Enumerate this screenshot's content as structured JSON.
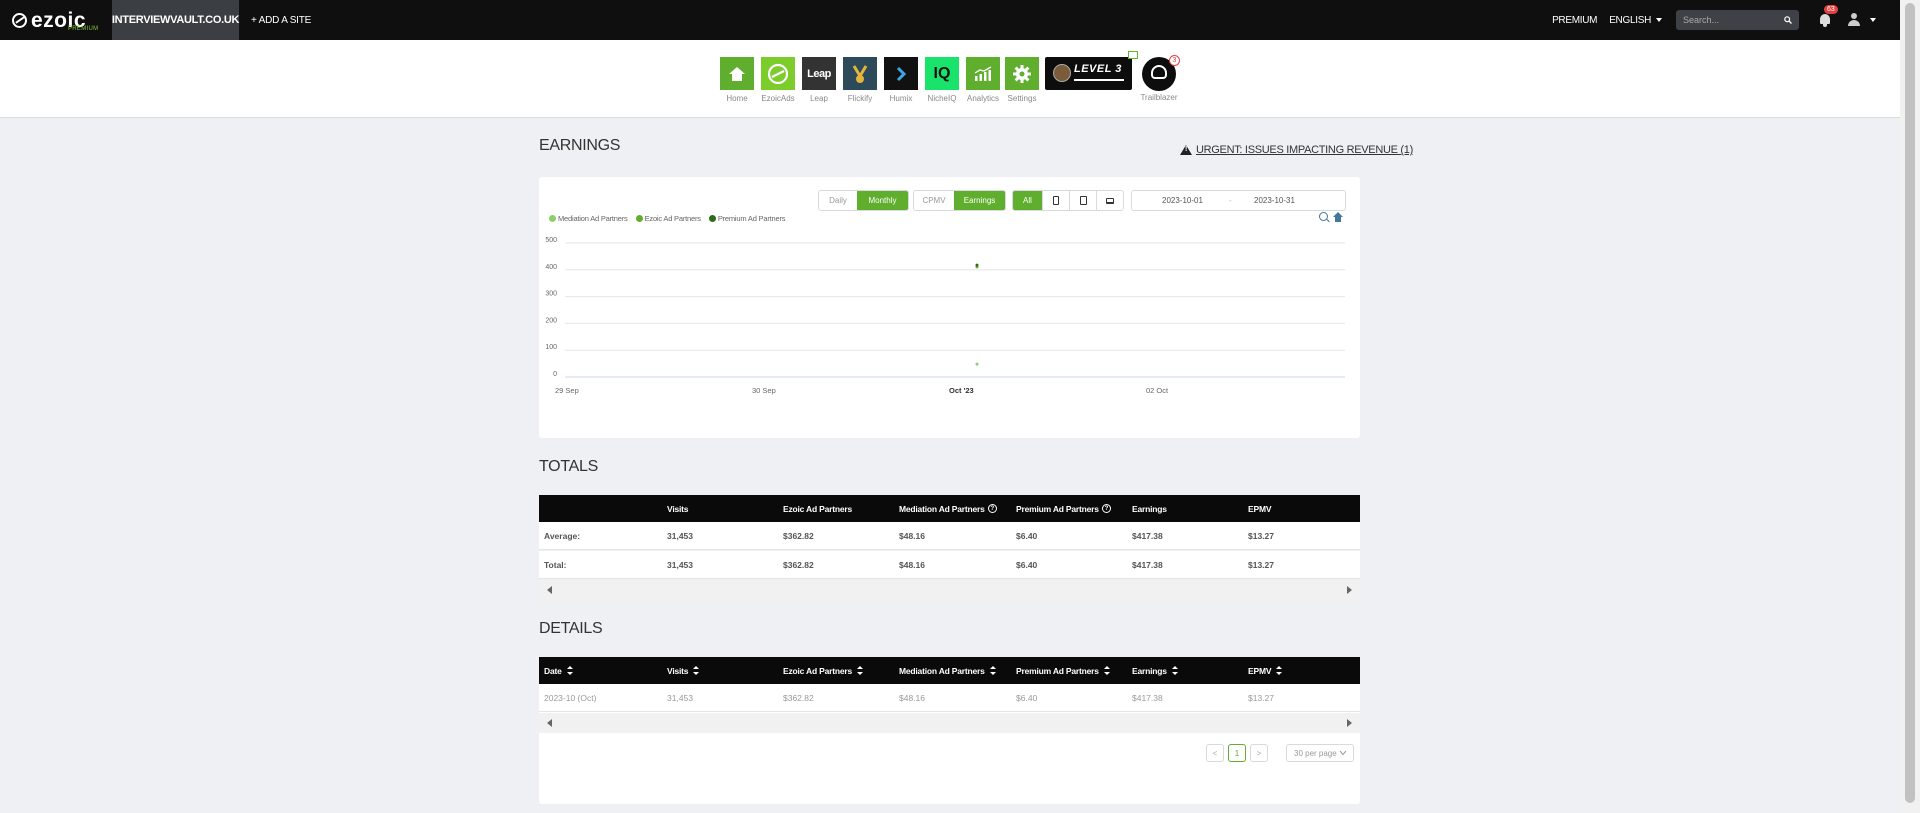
{
  "topbar": {
    "logo_text": "ezoic",
    "logo_sub": "PREMIUM",
    "site_name": "INTERVIEWVAULT.CO.UK",
    "add_site": "+ ADD A SITE",
    "premium": "PREMIUM",
    "language": "ENGLISH",
    "search_placeholder": "Search...",
    "notifications_count": "63"
  },
  "apps": [
    {
      "label": "Home",
      "color": "#5fae2e",
      "icon": "home-icon"
    },
    {
      "label": "EzoicAds",
      "color": "#7ccc2c",
      "icon": "ezoicads-icon"
    },
    {
      "label": "Leap",
      "color": "#333333",
      "icon": "leap-icon",
      "mark": "Leap"
    },
    {
      "label": "Flickify",
      "color": "#2d4a5a",
      "icon": "flickify-icon"
    },
    {
      "label": "Humix",
      "color": "#111111",
      "icon": "humix-icon"
    },
    {
      "label": "NicheIQ",
      "color": "#19e36b",
      "icon": "nicheiq-icon",
      "mark": "IQ"
    },
    {
      "label": "Analytics",
      "color": "#5fae2e",
      "icon": "analytics-icon"
    },
    {
      "label": "Settings",
      "color": "#5fae2e",
      "icon": "gear-icon"
    }
  ],
  "level": {
    "text": "LEVEL 3"
  },
  "trailblazer": {
    "label": "Trailblazer",
    "badge": "3"
  },
  "earnings": {
    "title": "EARNINGS",
    "urgent_link": "URGENT: ISSUES IMPACTING REVENUE (1)",
    "period_buttons": [
      "Daily",
      "Monthly"
    ],
    "metric_buttons": [
      "CPMV",
      "Earnings"
    ],
    "device_all": "All",
    "date_start": "2023-10-01",
    "date_sep": "-",
    "date_end": "2023-10-31"
  },
  "chart_data": {
    "type": "scatter",
    "title": "",
    "xlabel": "",
    "ylabel": "",
    "x_tick_labels": [
      "29 Sep",
      "30 Sep",
      "Oct '23",
      "02 Oct"
    ],
    "y_ticks": [
      0,
      100,
      200,
      300,
      400,
      500
    ],
    "ylim": [
      0,
      500
    ],
    "grid": true,
    "legend_placement": "top-left",
    "series": [
      {
        "name": "Mediation Ad Partners",
        "color": "#8fcf6a",
        "points": [
          {
            "x": "Oct '23",
            "y": 48.16
          }
        ]
      },
      {
        "name": "Ezoic Ad Partners",
        "color": "#5fae2e",
        "points": [
          {
            "x": "Oct '23",
            "y": 410.98
          }
        ]
      },
      {
        "name": "Premium Ad Partners",
        "color": "#2f6b19",
        "points": [
          {
            "x": "Oct '23",
            "y": 417.38
          }
        ]
      }
    ]
  },
  "totals": {
    "title": "TOTALS",
    "headers": [
      "",
      "Visits",
      "Ezoic Ad Partners",
      "Mediation Ad Partners",
      "Premium Ad Partners",
      "Earnings",
      "EPMV"
    ],
    "rows": [
      [
        "Average:",
        "31,453",
        "$362.82",
        "$48.16",
        "$6.40",
        "$417.38",
        "$13.27"
      ],
      [
        "Total:",
        "31,453",
        "$362.82",
        "$48.16",
        "$6.40",
        "$417.38",
        "$13.27"
      ]
    ]
  },
  "details": {
    "title": "DETAILS",
    "headers": [
      "Date",
      "Visits",
      "Ezoic Ad Partners",
      "Mediation Ad Partners",
      "Premium Ad Partners",
      "Earnings",
      "EPMV"
    ],
    "rows": [
      [
        "2023-10 (Oct)",
        "31,453",
        "$362.82",
        "$48.16",
        "$6.40",
        "$417.38",
        "$13.27"
      ]
    ],
    "pagination": {
      "prev": "<",
      "current": "1",
      "next": ">"
    },
    "per_page": "30 per page"
  }
}
